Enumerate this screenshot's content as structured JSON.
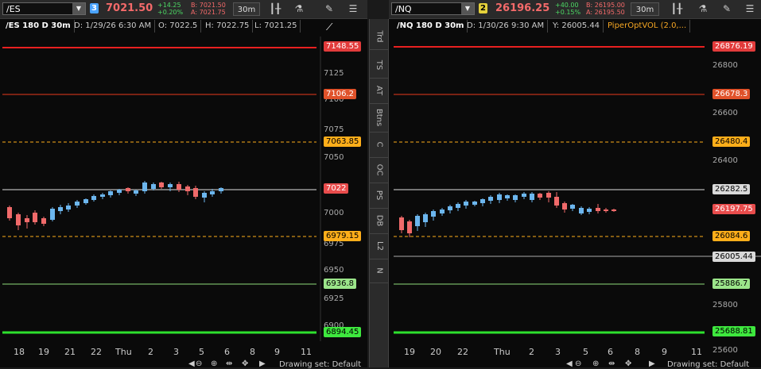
{
  "left": {
    "symbol": "/ES",
    "link_badge": "3",
    "link_color": "#4aa3ff",
    "price": "7021.50",
    "change_abs": "+14.25",
    "change_pct": "+0.20%",
    "bid": "B: 7021.50",
    "ask": "A: 7021.75",
    "timeframe": "30m",
    "header": {
      "title": "/ES 180 D 30m",
      "date": "D: 1/29/26 6:30 AM",
      "open": "O: 7022.5",
      "high": "H: 7022.75",
      "low": "L: 7021.25"
    },
    "y_labels": [
      "7125",
      "7100",
      "7075",
      "7050",
      "7000",
      "6975",
      "6950",
      "6925",
      "6900"
    ],
    "tags": [
      {
        "text": "7148.55",
        "bg": "#e23b3b",
        "fg": "#ffffff"
      },
      {
        "text": "7106.2",
        "bg": "#e0522a",
        "fg": "#ffffff"
      },
      {
        "text": "7063.85",
        "bg": "#ffae1a",
        "fg": "#000000"
      },
      {
        "text": "7022",
        "bg": "#e84c4c",
        "fg": "#ffffff"
      },
      {
        "text": "6979.15",
        "bg": "#ffae1a",
        "fg": "#000000"
      },
      {
        "text": "6936.8",
        "bg": "#9be58a",
        "fg": "#000000"
      },
      {
        "text": "6894.45",
        "bg": "#3ee83e",
        "fg": "#000000"
      }
    ],
    "x_labels": [
      "18",
      "19",
      "21",
      "22",
      "Thu",
      "2",
      "3",
      "5",
      "6",
      "8",
      "9",
      "11"
    ],
    "drawing_set": "Drawing set: Default"
  },
  "right": {
    "symbol": "/NQ",
    "link_badge": "2",
    "link_color": "#e5d13b",
    "price": "26196.25",
    "change_abs": "+40.00",
    "change_pct": "+0.15%",
    "bid": "B: 26195.00",
    "ask": "A: 26195.50",
    "timeframe": "30m",
    "header": {
      "title": "/NQ 180 D 30m",
      "date": "D: 1/30/26 9:30 AM",
      "y": "Y: 26005.44",
      "study": "PiperOptVOL (2.0,..."
    },
    "y_labels": [
      "26800",
      "26600",
      "26400",
      "26000",
      "25800",
      "25600"
    ],
    "tags": [
      {
        "text": "26876.19",
        "bg": "#e23b3b",
        "fg": "#ffffff"
      },
      {
        "text": "26678.3",
        "bg": "#e0522a",
        "fg": "#ffffff"
      },
      {
        "text": "26480.4",
        "bg": "#ffae1a",
        "fg": "#000000"
      },
      {
        "text": "26282.5",
        "bg": "#d9d9d9",
        "fg": "#000000"
      },
      {
        "text": "26197.75",
        "bg": "#e84c4c",
        "fg": "#ffffff"
      },
      {
        "text": "26084.6",
        "bg": "#ffae1a",
        "fg": "#000000"
      },
      {
        "text": "26005.44",
        "bg": "#d9d9d9",
        "fg": "#000000"
      },
      {
        "text": "25886.7",
        "bg": "#9be58a",
        "fg": "#000000"
      },
      {
        "text": "25688.81",
        "bg": "#3ee83e",
        "fg": "#000000"
      }
    ],
    "x_labels": [
      "19",
      "20",
      "22",
      "Thu",
      "2",
      "3",
      "5",
      "6",
      "8",
      "9",
      "11"
    ],
    "drawing_set": "Drawing set: Default"
  },
  "sidebar": [
    "Trd",
    "TS",
    "AT",
    "Btns",
    "C",
    "OC",
    "PS",
    "DB",
    "L2",
    "N"
  ],
  "colors": {
    "up": "#6cb6ee",
    "down": "#f06a6a"
  }
}
